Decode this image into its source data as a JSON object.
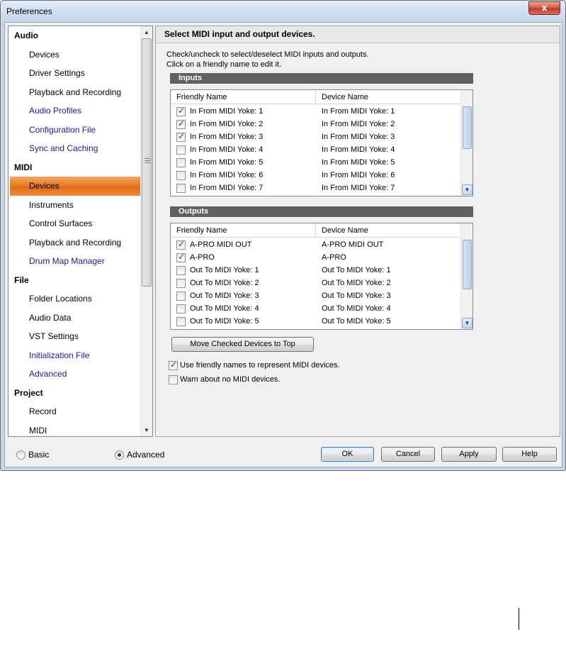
{
  "window": {
    "title": "Preferences",
    "close_label": "x"
  },
  "nav": {
    "sections": [
      {
        "title": "Audio",
        "items": [
          {
            "label": "Devices",
            "blue": false,
            "selected": false
          },
          {
            "label": "Driver Settings",
            "blue": false,
            "selected": false
          },
          {
            "label": "Playback and Recording",
            "blue": false,
            "selected": false
          },
          {
            "label": "Audio Profiles",
            "blue": true,
            "selected": false
          },
          {
            "label": "Configuration File",
            "blue": true,
            "selected": false
          },
          {
            "label": "Sync and Caching",
            "blue": true,
            "selected": false
          }
        ]
      },
      {
        "title": "MIDI",
        "items": [
          {
            "label": "Devices",
            "blue": false,
            "selected": true
          },
          {
            "label": "Instruments",
            "blue": false,
            "selected": false
          },
          {
            "label": "Control Surfaces",
            "blue": false,
            "selected": false
          },
          {
            "label": "Playback and Recording",
            "blue": false,
            "selected": false
          },
          {
            "label": "Drum Map Manager",
            "blue": true,
            "selected": false
          }
        ]
      },
      {
        "title": "File",
        "items": [
          {
            "label": "Folder Locations",
            "blue": false,
            "selected": false
          },
          {
            "label": "Audio Data",
            "blue": false,
            "selected": false
          },
          {
            "label": "VST Settings",
            "blue": false,
            "selected": false
          },
          {
            "label": "Initialization File",
            "blue": true,
            "selected": false
          },
          {
            "label": "Advanced",
            "blue": true,
            "selected": false
          }
        ]
      },
      {
        "title": "Project",
        "items": [
          {
            "label": "Record",
            "blue": false,
            "selected": false
          },
          {
            "label": "MIDI",
            "blue": false,
            "selected": false
          }
        ]
      }
    ]
  },
  "panel": {
    "header": "Select MIDI input and output devices.",
    "instructions_line1": "Check/uncheck to select/deselect MIDI inputs and outputs.",
    "instructions_line2": "Click on a friendly name to edit it.",
    "inputs": {
      "title": "Inputs",
      "col_friendly": "Friendly Name",
      "col_device": "Device Name",
      "rows": [
        {
          "checked": true,
          "friendly": "In From MIDI Yoke:  1",
          "device": "In From MIDI Yoke:  1"
        },
        {
          "checked": true,
          "friendly": "In From MIDI Yoke:  2",
          "device": "In From MIDI Yoke:  2"
        },
        {
          "checked": true,
          "friendly": "In From MIDI Yoke:  3",
          "device": "In From MIDI Yoke:  3"
        },
        {
          "checked": false,
          "friendly": "In From MIDI Yoke:  4",
          "device": "In From MIDI Yoke:  4"
        },
        {
          "checked": false,
          "friendly": "In From MIDI Yoke:  5",
          "device": "In From MIDI Yoke:  5"
        },
        {
          "checked": false,
          "friendly": "In From MIDI Yoke:  6",
          "device": "In From MIDI Yoke:  6"
        },
        {
          "checked": false,
          "friendly": "In From MIDI Yoke:  7",
          "device": "In From MIDI Yoke:  7"
        }
      ]
    },
    "outputs": {
      "title": "Outputs",
      "col_friendly": "Friendly Name",
      "col_device": "Device Name",
      "rows": [
        {
          "checked": true,
          "friendly": "A-PRO MIDI OUT",
          "device": "A-PRO MIDI OUT"
        },
        {
          "checked": true,
          "friendly": "A-PRO",
          "device": "A-PRO"
        },
        {
          "checked": false,
          "friendly": "Out To MIDI Yoke:  1",
          "device": "Out To MIDI Yoke:  1"
        },
        {
          "checked": false,
          "friendly": "Out To MIDI Yoke:  2",
          "device": "Out To MIDI Yoke:  2"
        },
        {
          "checked": false,
          "friendly": "Out To MIDI Yoke:  3",
          "device": "Out To MIDI Yoke:  3"
        },
        {
          "checked": false,
          "friendly": "Out To MIDI Yoke:  4",
          "device": "Out To MIDI Yoke:  4"
        },
        {
          "checked": false,
          "friendly": "Out To MIDI Yoke:  5",
          "device": "Out To MIDI Yoke:  5"
        }
      ]
    },
    "move_button": "Move Checked Devices to Top",
    "use_friendly": {
      "checked": true,
      "label": "Use friendly names to represent MIDI devices."
    },
    "warn_no_midi": {
      "checked": false,
      "label": "Warn about no MIDI devices."
    }
  },
  "footer": {
    "mode_basic": {
      "label": "Basic",
      "selected": false
    },
    "mode_advanced": {
      "label": "Advanced",
      "selected": true
    },
    "ok": "OK",
    "cancel": "Cancel",
    "apply": "Apply",
    "help": "Help"
  },
  "colors": {
    "selected_nav": "#e77a24",
    "section_bar": "#606060",
    "link_blue": "#1a1a9a"
  }
}
